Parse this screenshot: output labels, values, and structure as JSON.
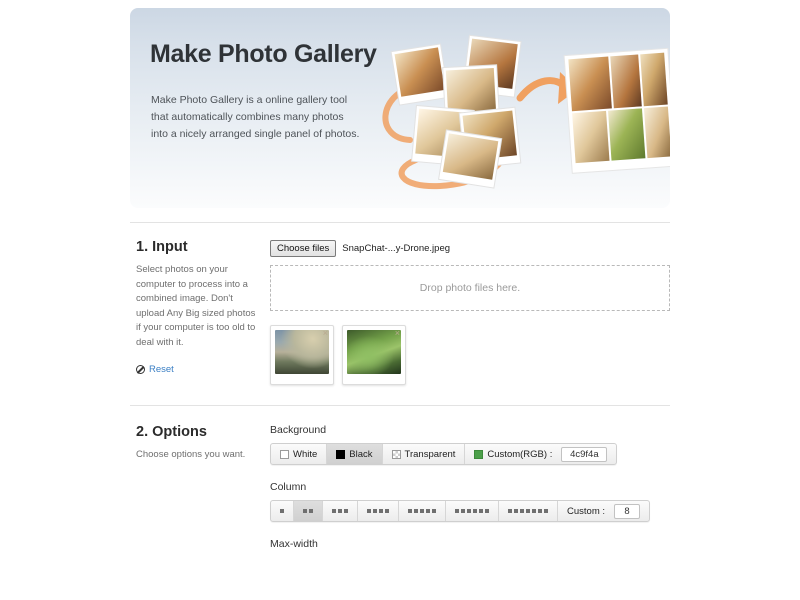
{
  "banner": {
    "title": "Make Photo Gallery",
    "description": "Make Photo Gallery is a online gallery tool that automatically combines many photos into a nicely arranged single panel of photos."
  },
  "input_section": {
    "title": "1. Input",
    "description": "Select photos on your computer to process into a combined image. Don't upload Any Big sized photos if your computer is too old to deal with it.",
    "reset_label": "Reset",
    "choose_files_label": "Choose files",
    "file_name": "SnapChat-...y-Drone.jpeg",
    "dropzone_text": "Drop photo files here.",
    "thumbnails": [
      {
        "name": "thumbnail-1",
        "remove_label": "×"
      },
      {
        "name": "thumbnail-2",
        "remove_label": "×"
      }
    ]
  },
  "options_section": {
    "title": "2. Options",
    "description": "Choose options you want.",
    "background": {
      "label": "Background",
      "choices": [
        {
          "label": "White",
          "swatch": "white-swatch",
          "selected": false
        },
        {
          "label": "Black",
          "swatch": "black-swatch",
          "selected": true
        },
        {
          "label": "Transparent",
          "swatch": "transparent-swatch",
          "selected": false
        }
      ],
      "custom_label": "Custom(RGB) :",
      "custom_swatch": "green-swatch",
      "custom_value": "4c9f4a"
    },
    "column": {
      "label": "Column",
      "choices": [
        {
          "dots": 1,
          "selected": false
        },
        {
          "dots": 2,
          "selected": true
        },
        {
          "dots": 3,
          "selected": false
        },
        {
          "dots": 4,
          "selected": false
        },
        {
          "dots": 5,
          "selected": false
        },
        {
          "dots": 6,
          "selected": false
        },
        {
          "dots": 7,
          "selected": false
        }
      ],
      "custom_label": "Custom :",
      "custom_value": "8"
    },
    "maxwidth": {
      "label": "Max-width"
    }
  },
  "colors": {
    "accent_green": "#4c9f4a",
    "link_blue": "#3b7fc4",
    "banner_top": "#ccd7e4",
    "arrow_orange": "#f0a060"
  }
}
